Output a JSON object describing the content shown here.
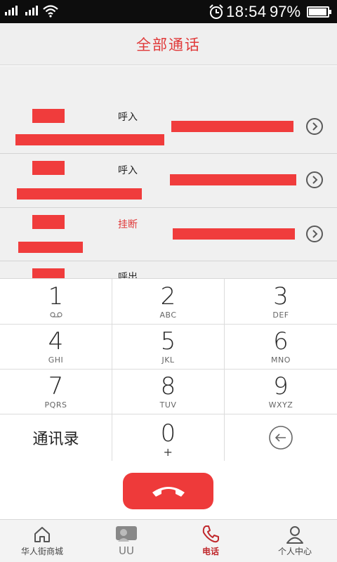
{
  "status_bar": {
    "time": "18:54",
    "battery": "97%",
    "battery_level": 0.97,
    "icons": [
      "signal-icon",
      "signal-icon",
      "wifi-icon",
      "alarm-icon",
      "battery-icon"
    ]
  },
  "header": {
    "title": "全部通话"
  },
  "call_log": [
    {
      "status": "呼入",
      "missed": false
    },
    {
      "status": "呼入",
      "missed": false
    },
    {
      "status": "挂断",
      "missed": true
    },
    {
      "status": "呼出",
      "missed": false
    }
  ],
  "keypad": {
    "keys": [
      {
        "digit": "1",
        "letters": ""
      },
      {
        "digit": "2",
        "letters": "ABC"
      },
      {
        "digit": "3",
        "letters": "DEF"
      },
      {
        "digit": "4",
        "letters": "GHI"
      },
      {
        "digit": "5",
        "letters": "JKL"
      },
      {
        "digit": "6",
        "letters": "MNO"
      },
      {
        "digit": "7",
        "letters": "PQRS"
      },
      {
        "digit": "8",
        "letters": "TUV"
      },
      {
        "digit": "9",
        "letters": "WXYZ"
      }
    ],
    "contacts_label": "通讯录",
    "zero": {
      "digit": "0",
      "letters": "+"
    }
  },
  "call_button": {
    "icon": "hangup-phone-icon",
    "color": "#ee3a3a"
  },
  "tabs": [
    {
      "label": "华人街商城",
      "icon": "home-icon",
      "active": false
    },
    {
      "label": "UU",
      "icon": "uu-icon",
      "active": false
    },
    {
      "label": "电话",
      "icon": "phone-icon",
      "active": true
    },
    {
      "label": "个人中心",
      "icon": "person-icon",
      "active": false
    }
  ],
  "colors": {
    "accent": "#e03a3a",
    "redaction": "#f03c3c"
  }
}
